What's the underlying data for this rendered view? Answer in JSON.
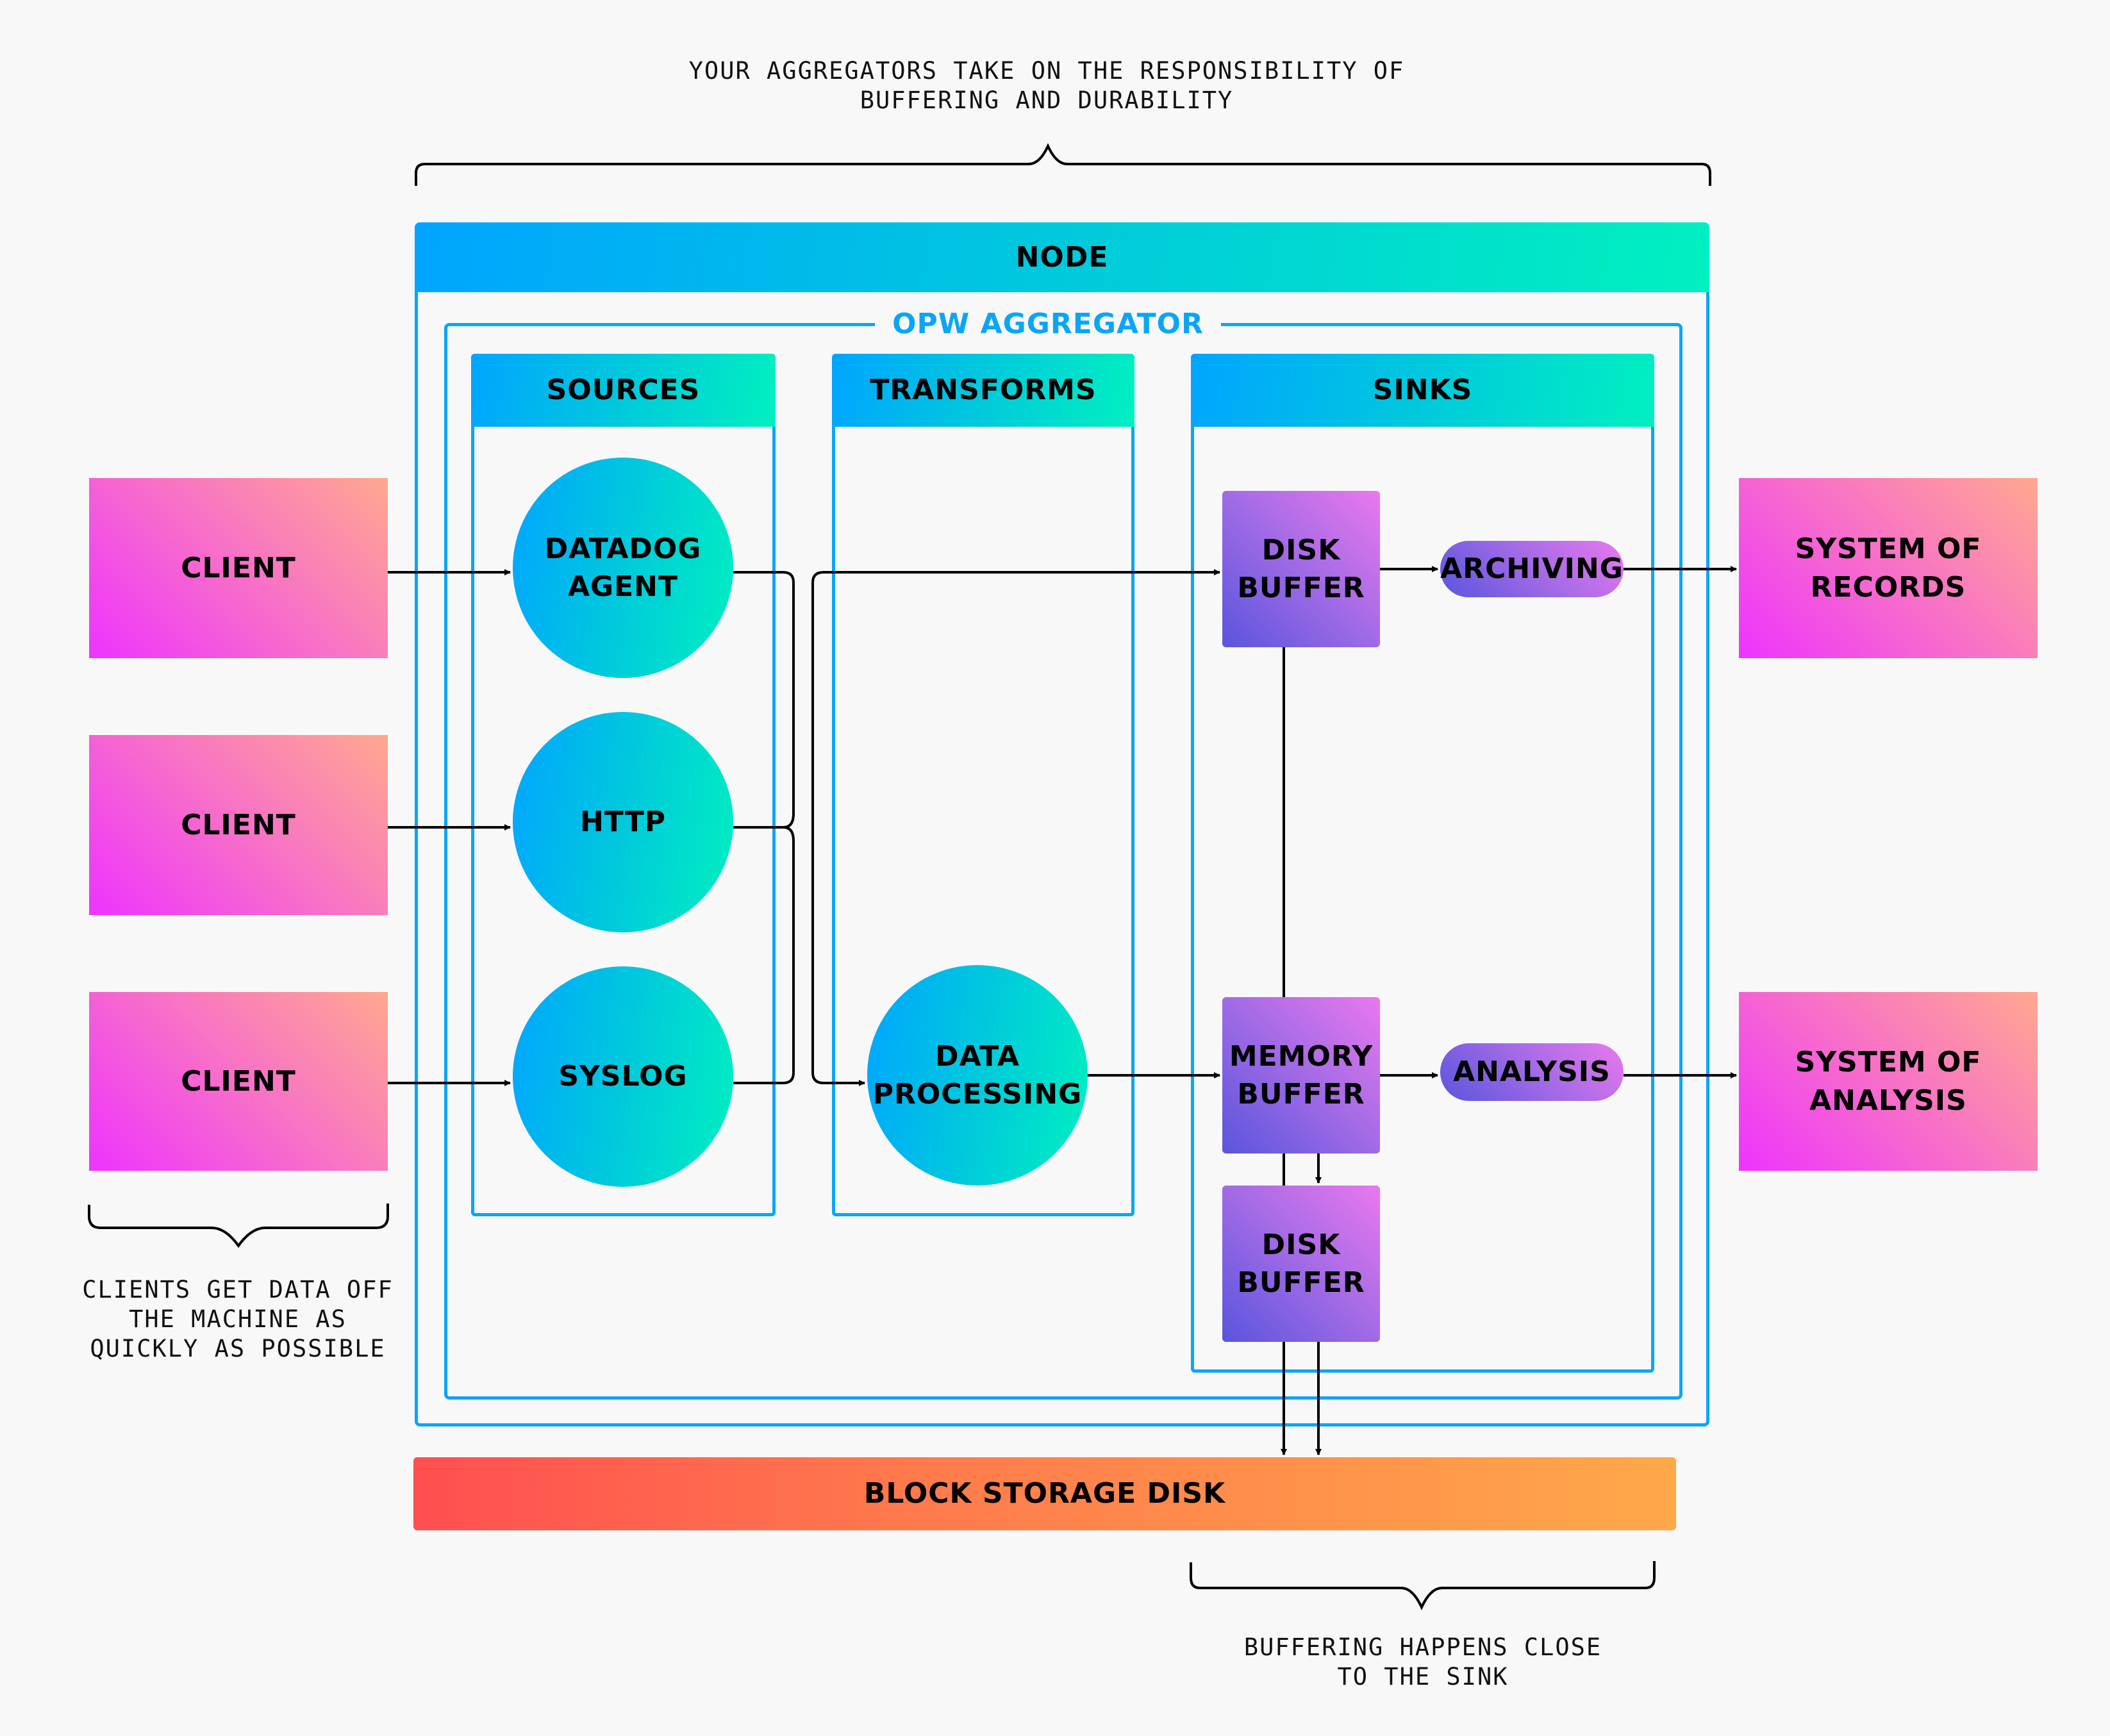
{
  "annotations": {
    "top": "YOUR AGGREGATORS TAKE ON THE RESPONSIBILITY OF\nBUFFERING AND DURABILITY",
    "left": "CLIENTS GET DATA OFF\nTHE MACHINE AS\nQUICKLY AS POSSIBLE",
    "bottom": "BUFFERING HAPPENS CLOSE\nTO THE SINK"
  },
  "node": {
    "title": "NODE"
  },
  "aggregator": {
    "title": "OPW AGGREGATOR"
  },
  "sources": {
    "title": "SOURCES",
    "items": [
      "DATADOG\nAGENT",
      "HTTP",
      "SYSLOG"
    ]
  },
  "transforms": {
    "title": "TRANSFORMS",
    "items": [
      "DATA\nPROCESSING"
    ]
  },
  "sinks": {
    "title": "SINKS",
    "disk_buffer_top": "DISK\nBUFFER",
    "memory_buffer": "MEMORY\nBUFFER",
    "disk_buffer_bottom": "DISK\nBUFFER",
    "archiving": "ARCHIVING",
    "analysis": "ANALYSIS"
  },
  "clients": [
    "CLIENT",
    "CLIENT",
    "CLIENT"
  ],
  "destinations": {
    "records": "SYSTEM OF\nRECORDS",
    "analysis": "SYSTEM OF\nANALYSIS"
  },
  "storage": {
    "title": "BLOCK STORAGE DISK"
  },
  "colors": {
    "container_border": "#0aa6f5",
    "aggregator_title": "#0aa6f5",
    "line": "#000000"
  }
}
